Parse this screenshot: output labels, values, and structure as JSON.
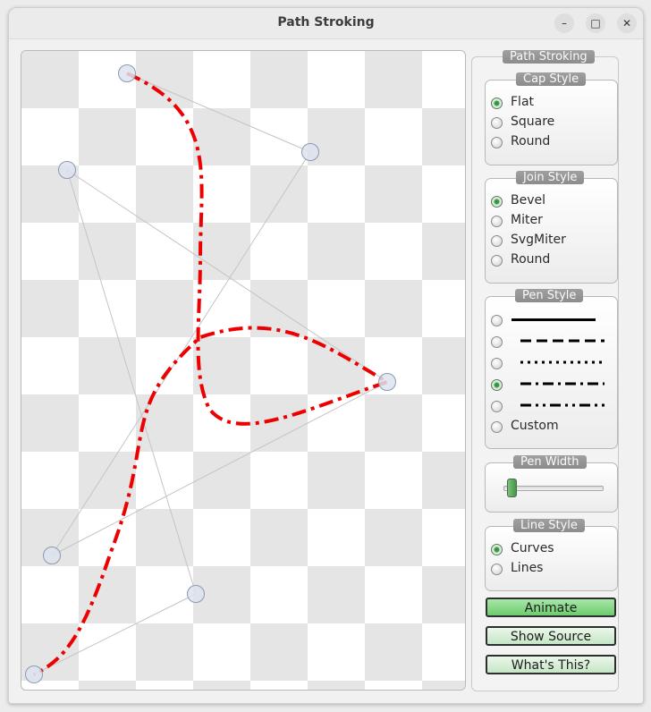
{
  "window": {
    "title": "Path Stroking",
    "minimize_label": "–",
    "maximize_label": "□",
    "close_label": "✕"
  },
  "panel": {
    "title": "Path Stroking",
    "cap_style": {
      "title": "Cap Style",
      "options": [
        "Flat",
        "Square",
        "Round"
      ],
      "selected": "Flat"
    },
    "join_style": {
      "title": "Join Style",
      "options": [
        "Bevel",
        "Miter",
        "SvgMiter",
        "Round"
      ],
      "selected": "Bevel"
    },
    "pen_style": {
      "title": "Pen Style",
      "options": [
        "solid-line",
        "dash-line",
        "dot-line",
        "dash-dot-line",
        "dash-dot-dot-line",
        "Custom"
      ],
      "custom_label": "Custom",
      "selected": "dash-dot-line"
    },
    "pen_width": {
      "title": "Pen Width",
      "value_fraction": 0.03
    },
    "line_style": {
      "title": "Line Style",
      "options": [
        "Curves",
        "Lines"
      ],
      "selected": "Curves"
    },
    "buttons": {
      "animate": "Animate",
      "show_source": "Show Source",
      "whats_this": "What's This?"
    }
  },
  "colors": {
    "stroke": "#ee0000",
    "checker": "#e5e5e5",
    "animate_button": "#8fdc8f",
    "button_light": "#d6eed6"
  }
}
